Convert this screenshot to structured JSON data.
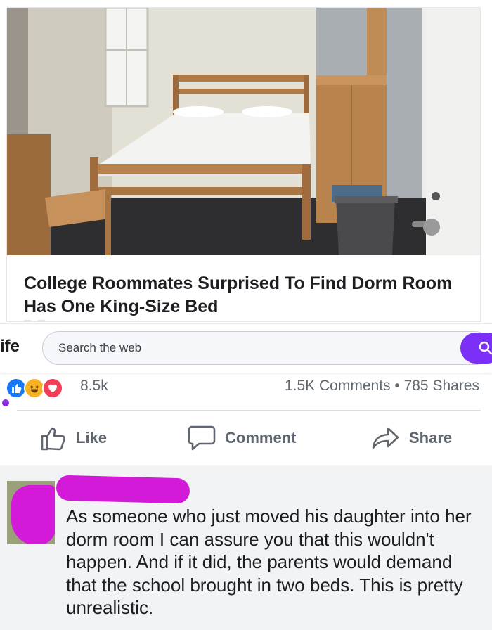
{
  "article": {
    "headline": "College Roommates Surprised To Find Dorm Room Has One King-Size Bed"
  },
  "search": {
    "brand_fragment": "ife",
    "placeholder": "Search the web",
    "button_color": "#7b2ff7",
    "button_icon": "search-icon"
  },
  "reactions": {
    "icons": [
      "like-icon",
      "haha-icon",
      "love-icon"
    ],
    "count": "8.5k",
    "comments": "1.5K Comments",
    "separator": "•",
    "shares": "785 Shares"
  },
  "actions": {
    "like_label": "Like",
    "comment_label": "Comment",
    "share_label": "Share"
  },
  "comment": {
    "text": "As someone who just moved his daughter into her dorm room I can assure you that this wouldn't happen. And if it did, the parents would demand that the school brought in two beds. This is pretty unrealistic."
  },
  "colors": {
    "like_blue": "#1877f2",
    "haha_yellow": "#f7b125",
    "love_red": "#f33e58",
    "scribble_magenta": "#d21ad8"
  }
}
